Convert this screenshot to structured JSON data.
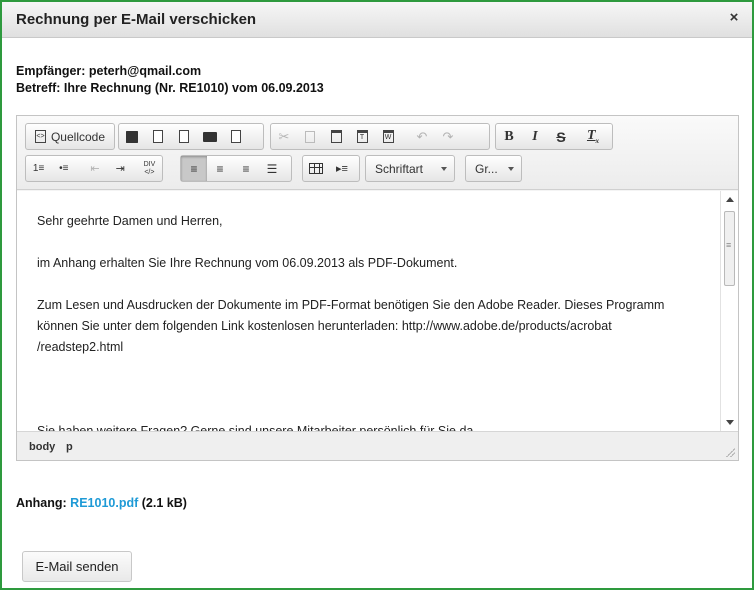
{
  "dialog": {
    "title": "Rechnung per E-Mail verschicken",
    "close_icon": "×"
  },
  "meta": {
    "recipient": "Empfänger: peterh@qmail.com",
    "subject": "Betreff: Ihre Rechnung (Nr. RE1010) vom 06.09.2013"
  },
  "toolbar": {
    "source_label": "Quellcode",
    "font_dropdown": "Schriftart",
    "size_dropdown": "Gr..."
  },
  "content": {
    "paragraphs": [
      "Sehr geehrte Damen und Herren,",
      "im Anhang erhalten Sie Ihre Rechnung vom 06.09.2013 als PDF-Dokument.",
      "Zum Lesen und Ausdrucken der Dokumente im PDF-Format benötigen Sie den Adobe Reader. Dieses Programm können Sie unter dem folgenden Link kostenlosen herunterladen: http://www.adobe.de/products/acrobat /readstep2.html",
      "",
      "Sie haben weitere Fragen? Gerne sind unsere Mitarbeiter persönlich für Sie da."
    ]
  },
  "statusbar": {
    "path": [
      "body",
      "p"
    ]
  },
  "attachment": {
    "label": "Anhang:",
    "filename": "RE1010.pdf",
    "size": "(2.1 kB)"
  },
  "actions": {
    "send_label": "E-Mail senden"
  }
}
